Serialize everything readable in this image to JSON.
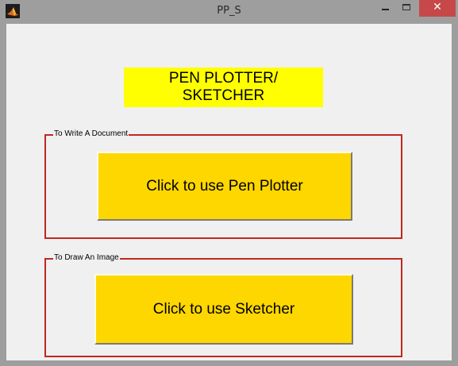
{
  "window": {
    "title": "PP_S",
    "close_glyph": "✕"
  },
  "banner": {
    "line1": "PEN PLOTTER/",
    "line2": "SKETCHER"
  },
  "panels": [
    {
      "label": "To Write A Document",
      "button_label": "Click to use Pen Plotter"
    },
    {
      "label": "To Draw An Image",
      "button_label": "Click to use Sketcher"
    }
  ],
  "colors": {
    "banner_bg": "#ffff00",
    "button_bg": "#ffd700",
    "panel_border": "#c0281e",
    "close_button": "#c74848"
  }
}
